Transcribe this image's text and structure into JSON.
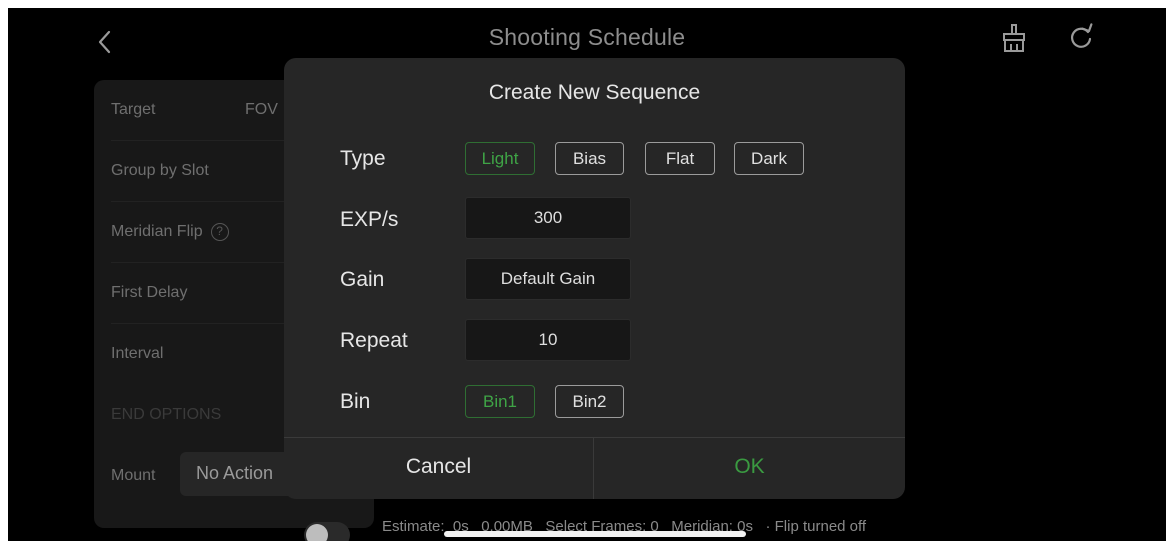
{
  "header": {
    "title": "Shooting Schedule",
    "back_icon": "chevron-left-icon",
    "broom_icon": "broom-icon",
    "refresh_icon": "refresh-icon"
  },
  "background_panel": {
    "target_label": "Target",
    "fov_label": "FOV",
    "group_label": "Group by Slot",
    "meridian_label": "Meridian Flip",
    "help_glyph": "?",
    "first_delay_label": "First Delay",
    "interval_label": "Interval",
    "end_options_label": "END OPTIONS",
    "mount_label": "Mount",
    "mount_value": "No Action"
  },
  "status": {
    "text": "Estimate:  0s   0.00MB   Select Frames: 0   Meridian: 0s   · Flip turned off"
  },
  "dialog": {
    "title": "Create New Sequence",
    "type": {
      "label": "Type",
      "options": [
        "Light",
        "Bias",
        "Flat",
        "Dark"
      ],
      "selected": "Light"
    },
    "exposure": {
      "label": "EXP/s",
      "value": "300"
    },
    "gain": {
      "label": "Gain",
      "value": "Default Gain"
    },
    "repeat": {
      "label": "Repeat",
      "value": "10"
    },
    "bin": {
      "label": "Bin",
      "options": [
        "Bin1",
        "Bin2"
      ],
      "selected": "Bin1"
    },
    "cancel_label": "Cancel",
    "ok_label": "OK"
  },
  "colors": {
    "background": "#000000",
    "dialog": "#262626",
    "accent_green": "#3fa446",
    "input_bg": "#171717"
  }
}
